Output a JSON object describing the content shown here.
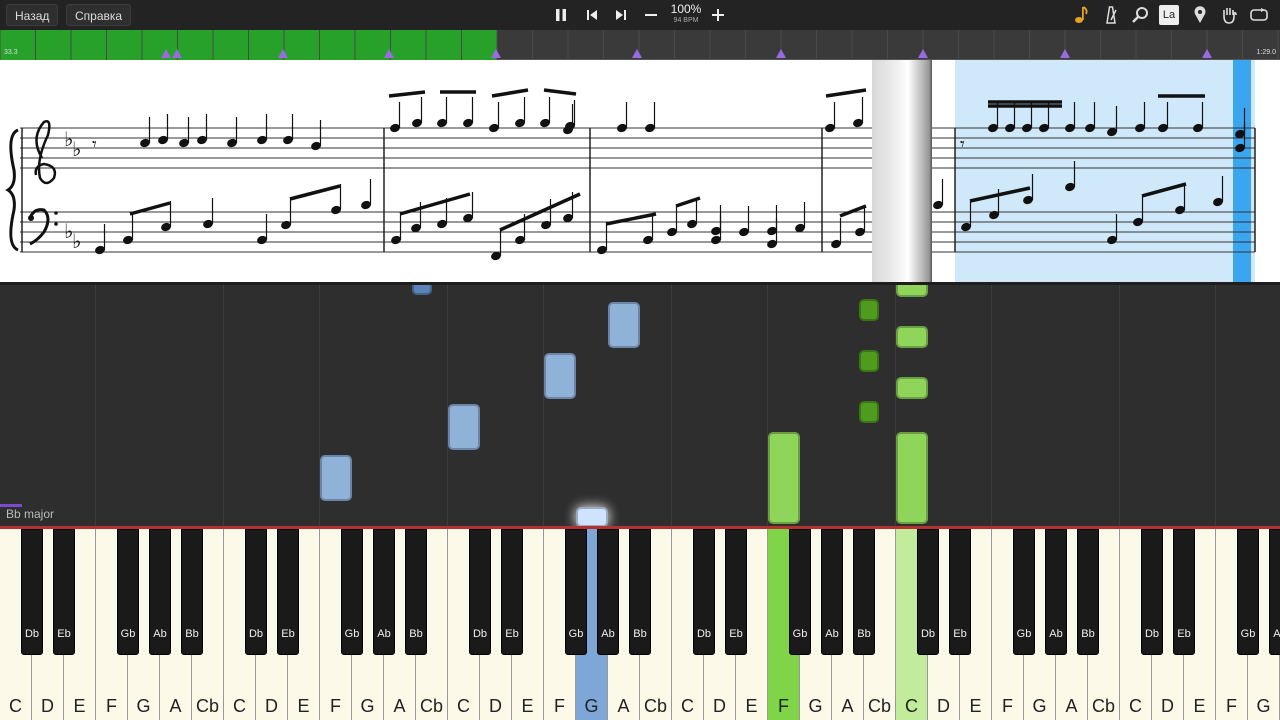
{
  "toolbar": {
    "back_label": "Назад",
    "help_label": "Справка",
    "tempo_percent": "100%",
    "tempo_bpm": "94 BPM",
    "play_icon": "pause-icon",
    "right_icons": [
      "music-note-icon",
      "metronome-icon",
      "magnifier-icon",
      "note-label-icon",
      "location-pin-icon",
      "hand-icon",
      "loop-icon"
    ],
    "note_label_text": "La",
    "colors": {
      "bg": "#232323",
      "note_icon": "#e3a51f"
    }
  },
  "timeline": {
    "start_time": "33.3",
    "end_time": "1:29.0",
    "played_fraction": 0.388,
    "colors": {
      "played": "#27a12a",
      "marker": "#9a6be0"
    }
  },
  "roll": {
    "key_signature": "Bb major",
    "colors": {
      "left_hand": "#8fb2d8",
      "right_hand": "#8fd55a"
    }
  },
  "keyboard": {
    "white_keys": [
      "C",
      "D",
      "E",
      "F",
      "G",
      "A",
      "Cb",
      "C",
      "D",
      "E",
      "F",
      "G",
      "A",
      "Cb",
      "C",
      "D",
      "E",
      "F",
      "G",
      "A",
      "Cb",
      "C",
      "D",
      "E",
      "F",
      "G",
      "A",
      "Cb",
      "C",
      "D",
      "E",
      "F",
      "G",
      "A",
      "Cb",
      "C",
      "D",
      "E",
      "F",
      "G"
    ],
    "black_keys": [
      "Db",
      "Eb",
      "Gb",
      "Ab",
      "Bb",
      "Db",
      "Eb",
      "Gb",
      "Ab",
      "Bb",
      "Db",
      "Eb",
      "Gb",
      "Ab",
      "Bb",
      "Db",
      "Eb",
      "Gb",
      "Ab",
      "Bb",
      "Db",
      "Eb",
      "Gb",
      "Ab",
      "Bb",
      "Db",
      "Eb",
      "Gb",
      "Ab",
      "Bb",
      "Db",
      "Eb",
      "Gb",
      ""
    ],
    "pressed": {
      "G": "blue",
      "F": "green",
      "C": "lightgreen"
    }
  }
}
